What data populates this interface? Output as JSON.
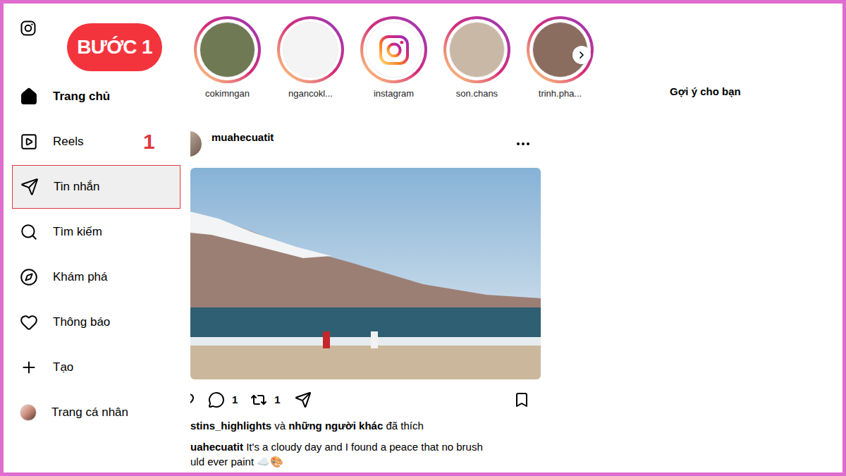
{
  "annotations": {
    "step_badge": "BƯỚC 1",
    "step_marker": "1"
  },
  "sidebar": {
    "items": [
      {
        "label": "Trang chủ",
        "kind": "icon",
        "selected": true,
        "highlighted": false
      },
      {
        "label": "Reels",
        "kind": "icon",
        "selected": false,
        "highlighted": false
      },
      {
        "label": "Tin nhắn",
        "kind": "icon",
        "selected": false,
        "highlighted": true
      },
      {
        "label": "Tìm kiếm",
        "kind": "icon",
        "selected": false,
        "highlighted": false
      },
      {
        "label": "Khám phá",
        "kind": "icon",
        "selected": false,
        "highlighted": false
      },
      {
        "label": "Thông báo",
        "kind": "icon",
        "selected": false,
        "highlighted": false
      },
      {
        "label": "Tạo",
        "kind": "icon",
        "selected": false,
        "highlighted": false
      },
      {
        "label": "Trang cá nhân",
        "kind": "avatar",
        "selected": false,
        "highlighted": false
      }
    ]
  },
  "stories": {
    "items": [
      {
        "username": "cokimngan",
        "kind": "photo"
      },
      {
        "username": "ngancokl...",
        "kind": "photo"
      },
      {
        "username": "instagram",
        "kind": "brand"
      },
      {
        "username": "son.chans",
        "kind": "photo"
      },
      {
        "username": "trinh.pha...",
        "kind": "photo"
      }
    ]
  },
  "suggestions": {
    "title": "Gợi ý cho bạn"
  },
  "post": {
    "username": "muahecuatit",
    "liked": false,
    "saved": false,
    "comment_count": "1",
    "repost_count": "1",
    "likes": {
      "user": "stins_highlights",
      "connector": "và",
      "others": "những người khác",
      "suffix": "đã thích"
    },
    "caption": {
      "user": "uahecuatit",
      "lines": [
        "It's a cloudy day and I found a peace that no brush",
        "uld ever paint ☁️🎨"
      ]
    }
  }
}
